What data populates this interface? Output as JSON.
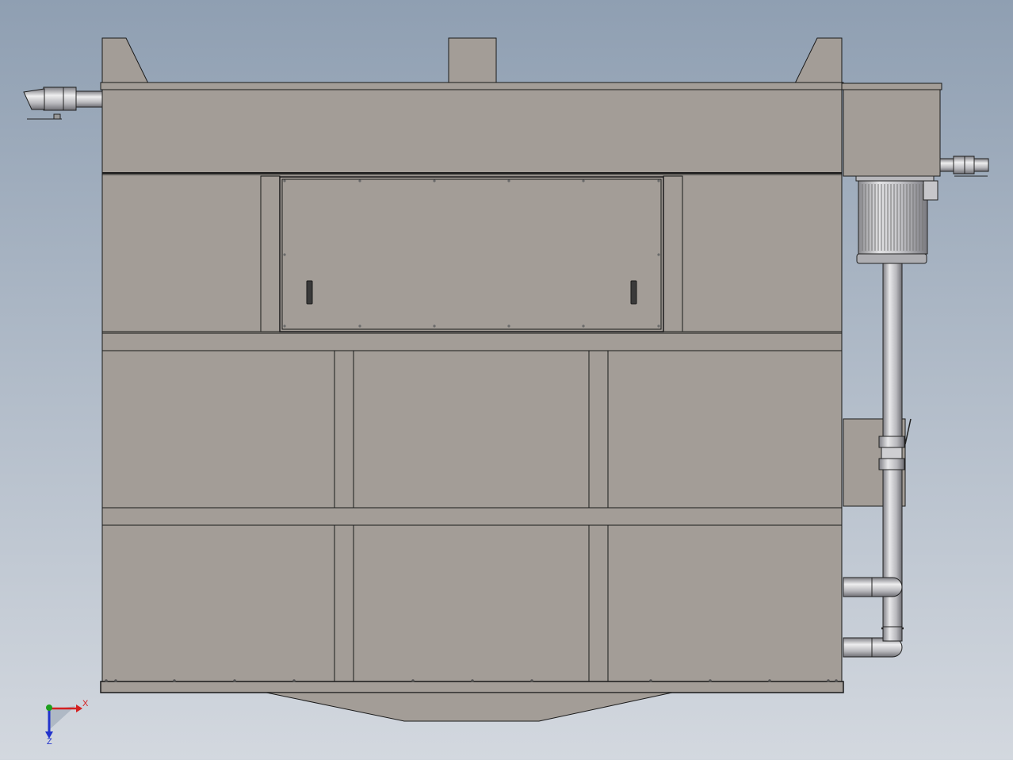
{
  "viewport": {
    "background_top": "#8f9fb2",
    "background_bottom": "#d3d8df"
  },
  "colors": {
    "body": "#a39d97",
    "body_dark": "#98918b",
    "line": "#1a1a1a",
    "pipe_light": "#e8e8ea",
    "pipe_mid": "#b8b8bc",
    "pipe_dark": "#7e7e84",
    "handle": "#3a3a3a"
  },
  "triad": {
    "x_label": "X",
    "z_label": "Z",
    "x_color": "#d42020",
    "y_color": "#1ea01e",
    "z_color": "#2233cc"
  }
}
